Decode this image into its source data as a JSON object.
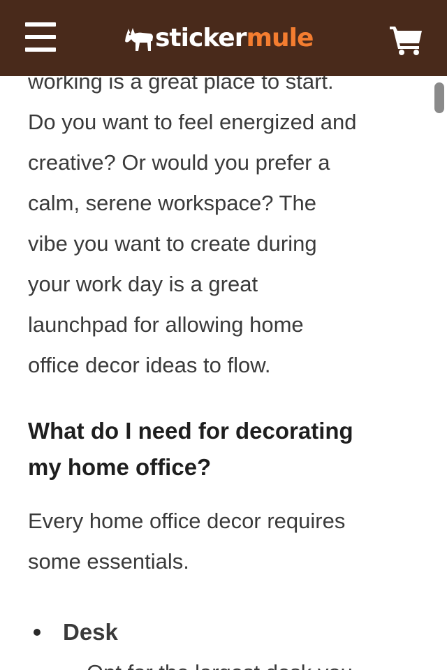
{
  "header": {
    "menu_icon": "hamburger-menu-icon",
    "logo": {
      "part1": "sticker",
      "part2": "mule",
      "icon": "mule-icon"
    },
    "cart_icon": "shopping-cart-icon",
    "background_color": "#492a1b",
    "accent_color": "#f47d30"
  },
  "article": {
    "intro_lines": [
      "working is a great place to start.",
      "Do you want to feel energized and",
      "creative? Or would you prefer a",
      "calm, serene workspace? The",
      "vibe you want to create during",
      "your work day is a great",
      "launchpad for allowing home",
      "office decor ideas to flow."
    ],
    "heading_lines": [
      "What do I need for decorating",
      "my home office?"
    ],
    "essentials_lines": [
      "Every home office decor requires",
      "some essentials."
    ],
    "list": [
      {
        "label": "Desk"
      }
    ],
    "partial_line": "Opt for the largest desk you"
  }
}
